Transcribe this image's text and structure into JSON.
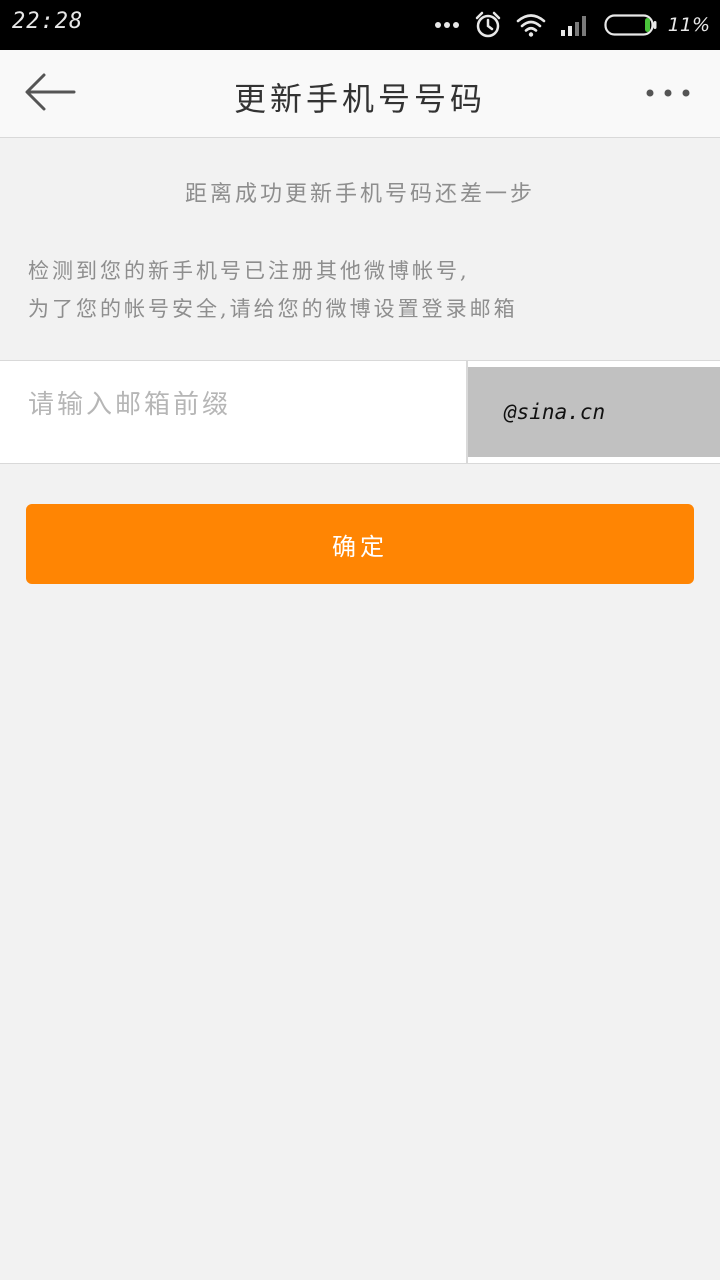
{
  "status_bar": {
    "time": "22:28",
    "battery_text": "11%",
    "icons": [
      "more-dots-icon",
      "alarm-icon",
      "wifi-icon",
      "signal-icon",
      "battery-icon"
    ]
  },
  "nav": {
    "title": "更新手机号号码",
    "back_icon": "back-arrow-icon",
    "more_icon": "more-icon"
  },
  "content": {
    "step_hint": "距离成功更新手机号码还差一步",
    "desc_line1": "检测到您的新手机号已注册其他微博帐号,",
    "desc_line2": "为了您的帐号安全,请给您的微博设置登录邮箱"
  },
  "email_form": {
    "prefix_placeholder": "请输入邮箱前缀",
    "prefix_value": "",
    "domain": "@sina.cn"
  },
  "confirm_button": {
    "label": "确定"
  },
  "colors": {
    "accent": "#ff8503",
    "background": "#f2f2f2",
    "status_bar": "#000000",
    "domain_box": "#c1c1c1"
  }
}
